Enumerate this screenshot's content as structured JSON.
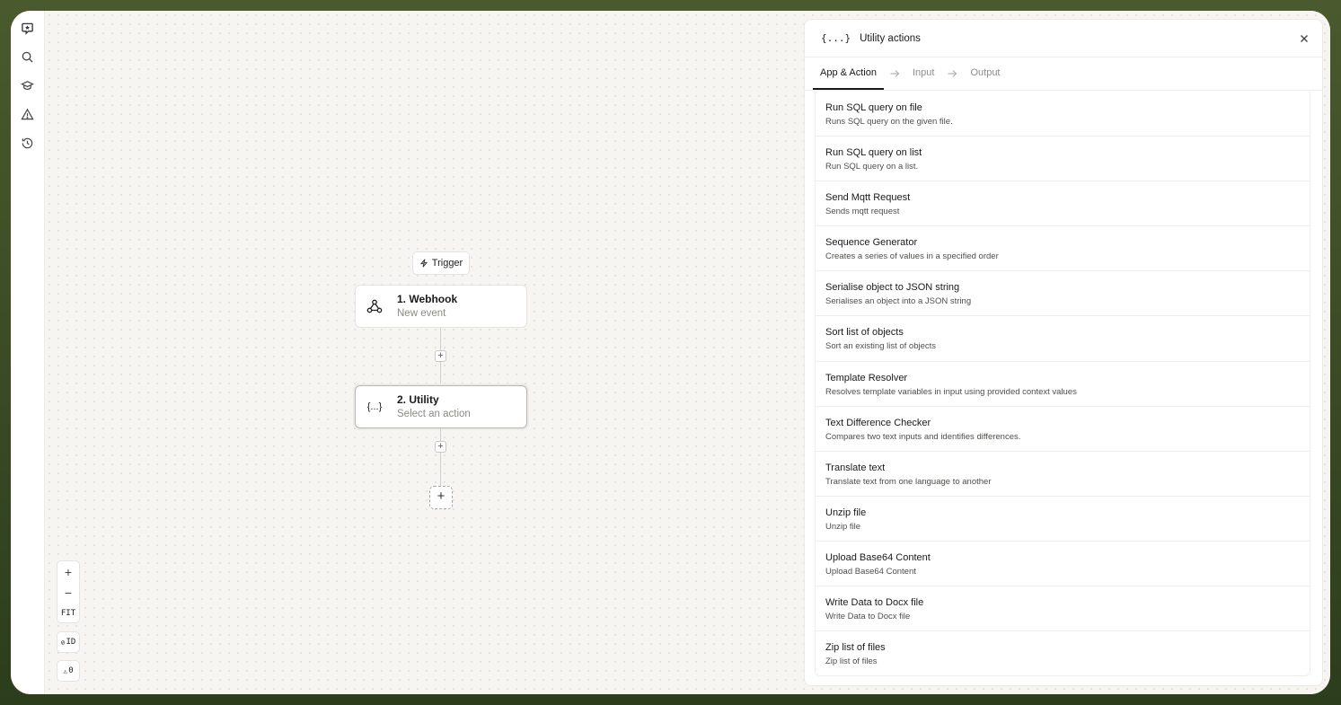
{
  "canvas": {
    "trigger_label": "Trigger",
    "steps": [
      {
        "title": "1. Webhook",
        "subtitle": "New event"
      },
      {
        "title": "2. Utility",
        "subtitle": "Select an action",
        "icon_text": "{...}"
      }
    ],
    "controls": {
      "zoom_in": "+",
      "zoom_out": "−",
      "fit": "FIT",
      "id_toggle": "ID",
      "warnings": "0"
    },
    "plus": "+"
  },
  "panel": {
    "icon_text": "{...}",
    "title": "Utility actions",
    "tabs": [
      "App & Action",
      "Input",
      "Output"
    ],
    "actions": [
      {
        "title": "Run SQL query on file",
        "desc": "Runs SQL query on the given file."
      },
      {
        "title": "Run SQL query on list",
        "desc": "Run SQL query on a list."
      },
      {
        "title": "Send Mqtt Request",
        "desc": "Sends mqtt request"
      },
      {
        "title": "Sequence Generator",
        "desc": "Creates a series of values in a specified order"
      },
      {
        "title": "Serialise object to JSON string",
        "desc": "Serialises an object into a JSON string"
      },
      {
        "title": "Sort list of objects",
        "desc": "Sort an existing list of objects"
      },
      {
        "title": "Template Resolver",
        "desc": "Resolves template variables in input using provided context values"
      },
      {
        "title": "Text Difference Checker",
        "desc": "Compares two text inputs and identifies differences."
      },
      {
        "title": "Translate text",
        "desc": "Translate text from one language to another"
      },
      {
        "title": "Unzip file",
        "desc": "Unzip file"
      },
      {
        "title": "Upload Base64 Content",
        "desc": "Upload Base64 Content"
      },
      {
        "title": "Write Data to Docx file",
        "desc": "Write Data to Docx file"
      },
      {
        "title": "Zip list of files",
        "desc": "Zip list of files"
      }
    ]
  },
  "icons": {
    "rail": [
      "logo-icon",
      "search-icon",
      "graduation-cap-icon",
      "warning-icon",
      "history-icon"
    ]
  }
}
